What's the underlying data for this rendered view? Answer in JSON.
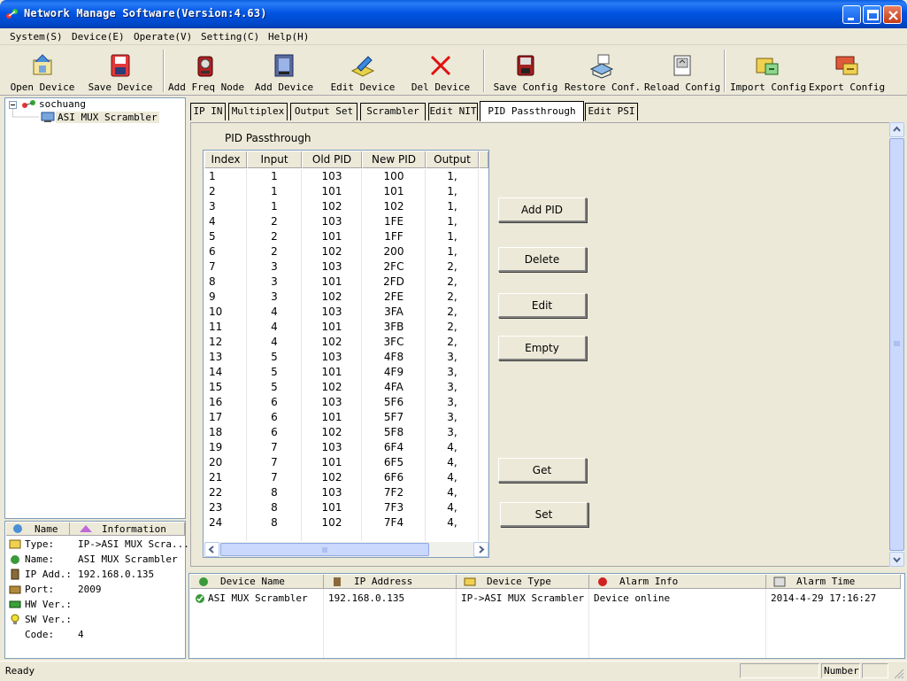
{
  "window": {
    "title": "Network Manage Software(Version:4.63)"
  },
  "menu": [
    {
      "label": "System(S)"
    },
    {
      "label": "Device(E)"
    },
    {
      "label": "Operate(V)"
    },
    {
      "label": "Setting(C)"
    },
    {
      "label": "Help(H)"
    }
  ],
  "toolbar": {
    "open_device": "Open Device",
    "save_device": "Save Device",
    "add_freq_node": "Add Freq Node",
    "add_device": "Add Device",
    "edit_device": "Edit Device",
    "del_device": "Del Device",
    "save_config": "Save Config",
    "restore_conf": "Restore Conf.",
    "reload_config": "Reload Config",
    "import_config": "Import Config",
    "export_config": "Export Config"
  },
  "tree": {
    "root": "sochuang",
    "child": "ASI MUX Scrambler"
  },
  "info": {
    "headers": {
      "name": "Name",
      "information": "Information"
    },
    "rows": [
      {
        "key": "Type:",
        "value": "IP->ASI MUX Scra..."
      },
      {
        "key": "Name:",
        "value": "ASI MUX Scrambler"
      },
      {
        "key": "IP Add.:",
        "value": "192.168.0.135"
      },
      {
        "key": "Port:",
        "value": "2009"
      },
      {
        "key": "HW Ver.:",
        "value": ""
      },
      {
        "key": "SW Ver.:",
        "value": ""
      },
      {
        "key": "Code:",
        "value": "4"
      }
    ]
  },
  "tabs": [
    {
      "label": "IP IN"
    },
    {
      "label": "Multiplex"
    },
    {
      "label": "Output Set"
    },
    {
      "label": "Scrambler"
    },
    {
      "label": "Edit NIT"
    },
    {
      "label": "PID Passthrough",
      "active": true
    },
    {
      "label": "Edit PSI"
    }
  ],
  "pid": {
    "title": "PID Passthrough",
    "columns": [
      "Index",
      "Input",
      "Old PID",
      "New PID",
      "Output"
    ],
    "rows": [
      [
        "1",
        "1",
        "103",
        "100",
        "1,"
      ],
      [
        "2",
        "1",
        "101",
        "101",
        "1,"
      ],
      [
        "3",
        "1",
        "102",
        "102",
        "1,"
      ],
      [
        "4",
        "2",
        "103",
        "1FE",
        "1,"
      ],
      [
        "5",
        "2",
        "101",
        "1FF",
        "1,"
      ],
      [
        "6",
        "2",
        "102",
        "200",
        "1,"
      ],
      [
        "7",
        "3",
        "103",
        "2FC",
        "2,"
      ],
      [
        "8",
        "3",
        "101",
        "2FD",
        "2,"
      ],
      [
        "9",
        "3",
        "102",
        "2FE",
        "2,"
      ],
      [
        "10",
        "4",
        "103",
        "3FA",
        "2,"
      ],
      [
        "11",
        "4",
        "101",
        "3FB",
        "2,"
      ],
      [
        "12",
        "4",
        "102",
        "3FC",
        "2,"
      ],
      [
        "13",
        "5",
        "103",
        "4F8",
        "3,"
      ],
      [
        "14",
        "5",
        "101",
        "4F9",
        "3,"
      ],
      [
        "15",
        "5",
        "102",
        "4FA",
        "3,"
      ],
      [
        "16",
        "6",
        "103",
        "5F6",
        "3,"
      ],
      [
        "17",
        "6",
        "101",
        "5F7",
        "3,"
      ],
      [
        "18",
        "6",
        "102",
        "5F8",
        "3,"
      ],
      [
        "19",
        "7",
        "103",
        "6F4",
        "4,"
      ],
      [
        "20",
        "7",
        "101",
        "6F5",
        "4,"
      ],
      [
        "21",
        "7",
        "102",
        "6F6",
        "4,"
      ],
      [
        "22",
        "8",
        "103",
        "7F2",
        "4,"
      ],
      [
        "23",
        "8",
        "101",
        "7F3",
        "4,"
      ],
      [
        "24",
        "8",
        "102",
        "7F4",
        "4,"
      ]
    ],
    "buttons": {
      "add_pid": "Add PID",
      "delete": "Delete",
      "edit": "Edit",
      "empty": "Empty",
      "get": "Get",
      "set": "Set"
    }
  },
  "log": {
    "columns": [
      "Device Name",
      "IP Address",
      "Device Type",
      "Alarm Info",
      "Alarm Time"
    ],
    "rows": [
      [
        "ASI MUX Scrambler",
        "192.168.0.135",
        "IP->ASI MUX Scrambler",
        "Device online",
        "2014-4-29 17:16:27"
      ]
    ]
  },
  "status": {
    "text": "Ready",
    "number_label": "Number"
  },
  "colors": {
    "title_blue": "#0054e3",
    "face": "#ece9d8",
    "border_blue": "#7f9db9"
  }
}
